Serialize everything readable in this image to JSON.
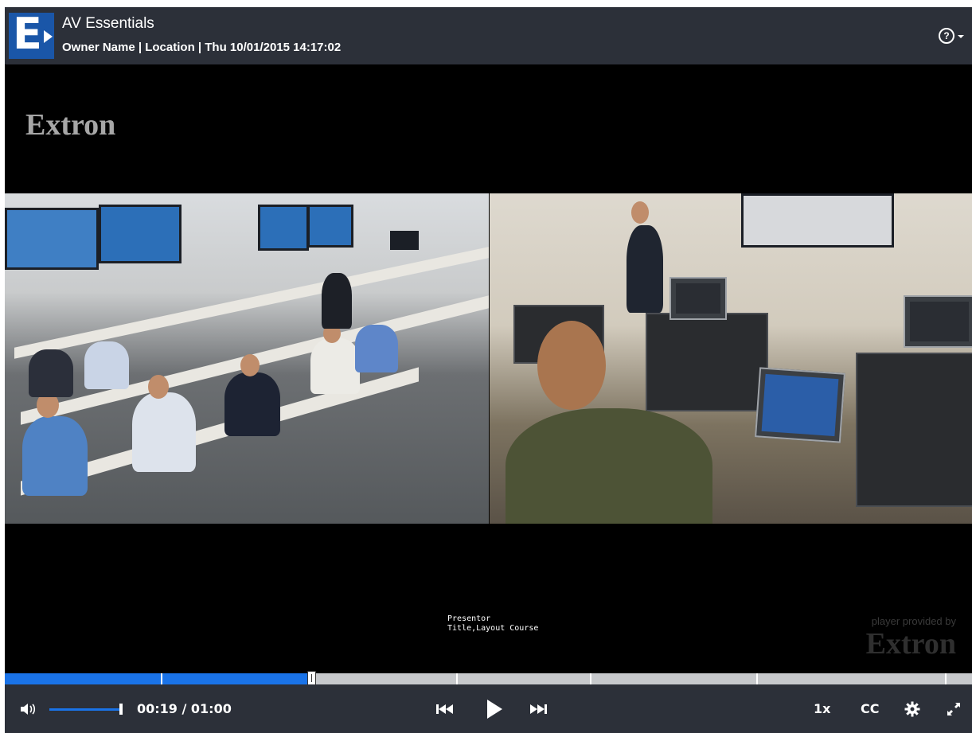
{
  "header": {
    "app_title": "AV Essentials",
    "subtitle": "Owner Name | Location | Thu 10/01/2015  14:17:02",
    "logo_icon": "extron-e-logo",
    "help_icon": "help-circle-dropdown-icon"
  },
  "video": {
    "brand_top": "Extron",
    "caption": "Presentor\nTitle,Layout Course",
    "provided_by": "player provided by",
    "brand_bottom": "Extron"
  },
  "progress": {
    "played_fraction": 0.3167,
    "chapter_markers_seconds": [
      9.7,
      28.0,
      36.3,
      46.6,
      58.3
    ]
  },
  "controls": {
    "time_display": "00:19 / 01:00",
    "current_time": "00:19",
    "duration": "01:00",
    "volume_level": 0.95,
    "speed_label": "1x",
    "cc_label": "CC",
    "icons": [
      "volume-icon",
      "previous-chapter-icon",
      "play-icon",
      "next-chapter-icon",
      "settings-gear-icon",
      "fullscreen-icon"
    ]
  },
  "colors": {
    "header_bg": "#2c3039",
    "accent_blue": "#1a73e8",
    "logo_blue": "#1a56a8"
  }
}
